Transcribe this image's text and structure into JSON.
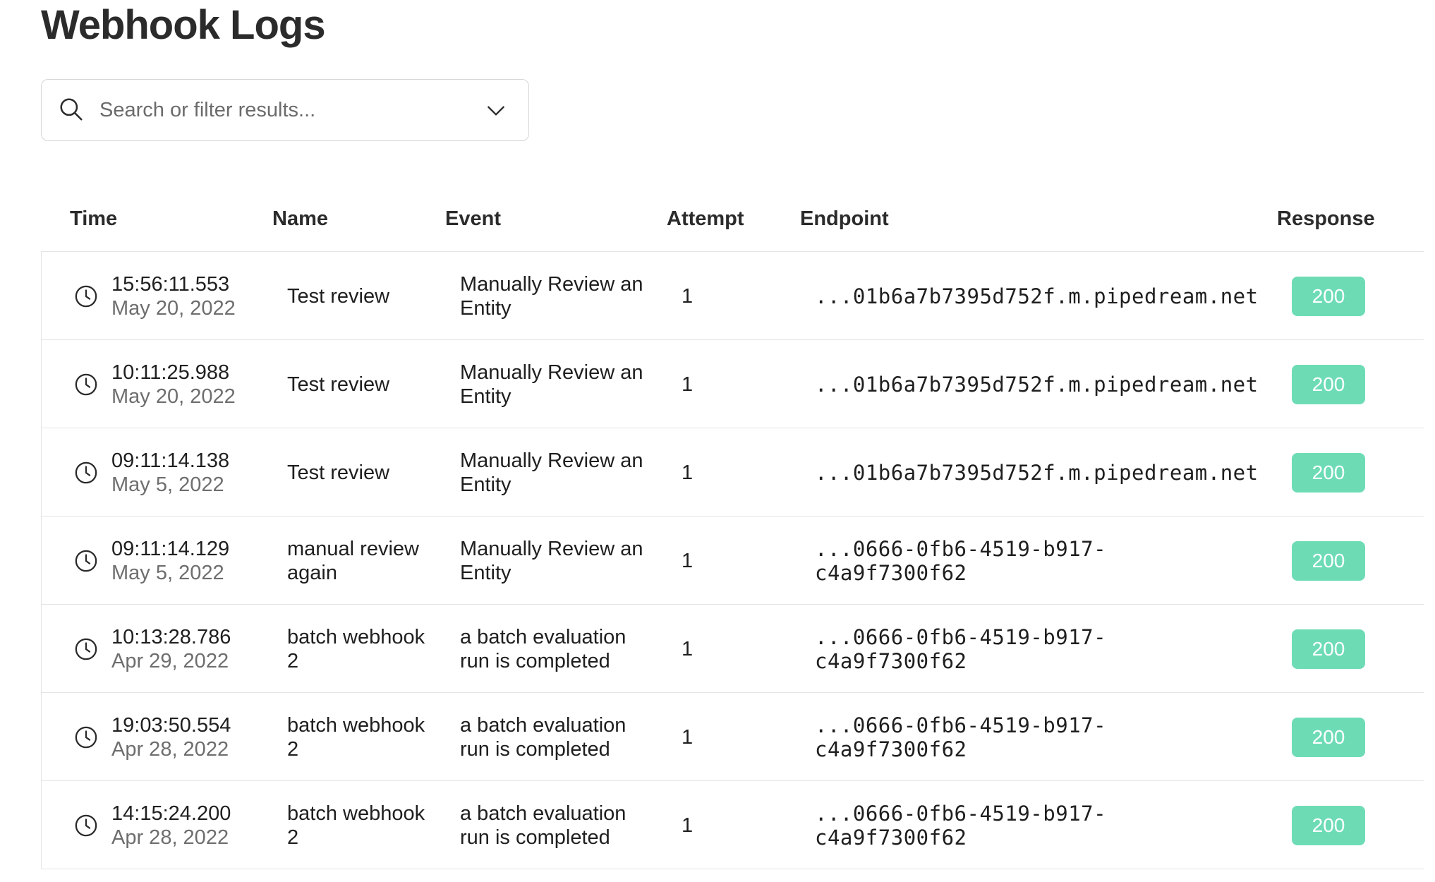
{
  "page": {
    "title": "Webhook Logs"
  },
  "search": {
    "placeholder": "Search or filter results...",
    "icon": "search-icon",
    "dropdown_icon": "chevron-down-icon"
  },
  "table": {
    "columns": [
      "Time",
      "Name",
      "Event",
      "Attempt",
      "Endpoint",
      "Response"
    ],
    "rows": [
      {
        "time": "15:56:11.553",
        "date": "May 20, 2022",
        "name": "Test review",
        "event": "Manually Review an Entity",
        "attempt": "1",
        "endpoint": "...01b6a7b7395d752f.m.pipedream.net",
        "response": "200"
      },
      {
        "time": "10:11:25.988",
        "date": "May 20, 2022",
        "name": "Test review",
        "event": "Manually Review an Entity",
        "attempt": "1",
        "endpoint": "...01b6a7b7395d752f.m.pipedream.net",
        "response": "200"
      },
      {
        "time": "09:11:14.138",
        "date": "May 5, 2022",
        "name": "Test review",
        "event": "Manually Review an Entity",
        "attempt": "1",
        "endpoint": "...01b6a7b7395d752f.m.pipedream.net",
        "response": "200"
      },
      {
        "time": "09:11:14.129",
        "date": "May 5, 2022",
        "name": "manual review again",
        "event": "Manually Review an Entity",
        "attempt": "1",
        "endpoint": "...0666-0fb6-4519-b917-c4a9f7300f62",
        "response": "200"
      },
      {
        "time": "10:13:28.786",
        "date": "Apr 29, 2022",
        "name": "batch webhook 2",
        "event": "a batch evaluation run is completed",
        "attempt": "1",
        "endpoint": "...0666-0fb6-4519-b917-c4a9f7300f62",
        "response": "200"
      },
      {
        "time": "19:03:50.554",
        "date": "Apr 28, 2022",
        "name": "batch webhook 2",
        "event": "a batch evaluation run is completed",
        "attempt": "1",
        "endpoint": "...0666-0fb6-4519-b917-c4a9f7300f62",
        "response": "200"
      },
      {
        "time": "14:15:24.200",
        "date": "Apr 28, 2022",
        "name": "batch webhook 2",
        "event": "a batch evaluation run is completed",
        "attempt": "1",
        "endpoint": "...0666-0fb6-4519-b917-c4a9f7300f62",
        "response": "200"
      }
    ]
  },
  "colors": {
    "success_badge": "#6ddcb5",
    "border": "#e4e4e4",
    "muted_text": "#6e6e6e"
  }
}
